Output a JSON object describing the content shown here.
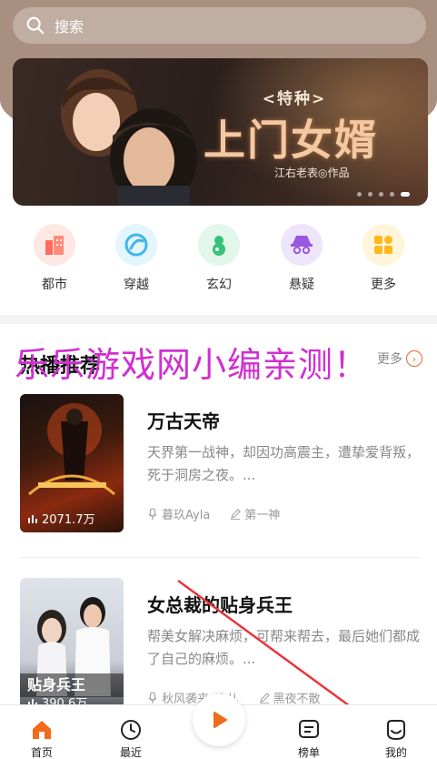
{
  "search": {
    "placeholder": "搜索"
  },
  "banner": {
    "subtitle": "<特种>",
    "title": "上门女婿",
    "author": "江右老表◎作品",
    "dots": 5,
    "active_dot": 4
  },
  "categories": [
    {
      "label": "都市",
      "icon": "city-icon",
      "color": "#ff6b5b",
      "bg": "#ffe8e4"
    },
    {
      "label": "穿越",
      "icon": "portal-icon",
      "color": "#3fb6e8",
      "bg": "#e3f5fd"
    },
    {
      "label": "玄幻",
      "icon": "gourd-icon",
      "color": "#35c27a",
      "bg": "#e2f7ea"
    },
    {
      "label": "悬疑",
      "icon": "detective-icon",
      "color": "#9a58e0",
      "bg": "#efe5fb"
    },
    {
      "label": "更多",
      "icon": "grid-icon",
      "color": "#ffb81c",
      "bg": "#fff5da"
    }
  ],
  "section": {
    "title": "热播推荐",
    "more_label": "更多"
  },
  "watermark": "乐乐游戏网小编亲测！",
  "books": [
    {
      "title": "万古天帝",
      "description": "天界第一战神，却因功高震主，遭挚爱背叛，死于洞房之夜。...",
      "plays": "2071.7万",
      "narrator": "暮玖Ayla",
      "author": "第一神"
    },
    {
      "title": "女总裁的贴身兵王",
      "description": "帮美女解决麻烦，可帮来帮去，最后她们都成了自己的麻烦。...",
      "plays": "390.6万",
      "narrator": "秋风袭来_逸儿",
      "author": "黑夜不散"
    }
  ],
  "tabs": [
    {
      "label": "首页",
      "active": true
    },
    {
      "label": "最近"
    },
    {
      "label": "榜单"
    },
    {
      "label": "我的"
    }
  ],
  "colors": {
    "accent": "#f26a1b",
    "watermark": "#d12fd1",
    "arrow": "#e8363d"
  }
}
